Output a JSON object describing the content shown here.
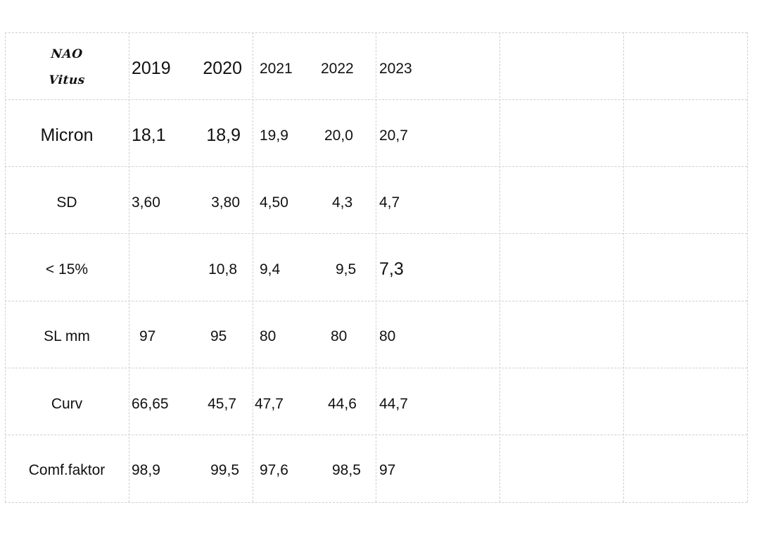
{
  "table": {
    "corner": {
      "line1": "NAO",
      "line2": "Vitus"
    },
    "years": [
      "2019",
      "2020",
      "2021",
      "2022",
      "2023"
    ],
    "rows": [
      {
        "label": "Micron",
        "values": [
          "18,1",
          "18,9",
          "19,9",
          "20,0",
          "20,7"
        ]
      },
      {
        "label": "SD",
        "values": [
          "3,60",
          "3,80",
          "4,50",
          "4,3",
          "4,7"
        ]
      },
      {
        "label": "< 15%",
        "values": [
          "",
          "10,8",
          "9,4",
          "9,5",
          "7,3"
        ]
      },
      {
        "label": "SL mm",
        "values": [
          "97",
          "95",
          "80",
          "80",
          "80"
        ]
      },
      {
        "label": "Curv",
        "values": [
          "66,65",
          "45,7",
          "47,7",
          "44,6",
          "44,7"
        ]
      },
      {
        "label": "Comf.faktor",
        "values": [
          "98,9",
          "99,5",
          "97,6",
          "98,5",
          "97"
        ]
      }
    ],
    "empty_columns": 2
  }
}
